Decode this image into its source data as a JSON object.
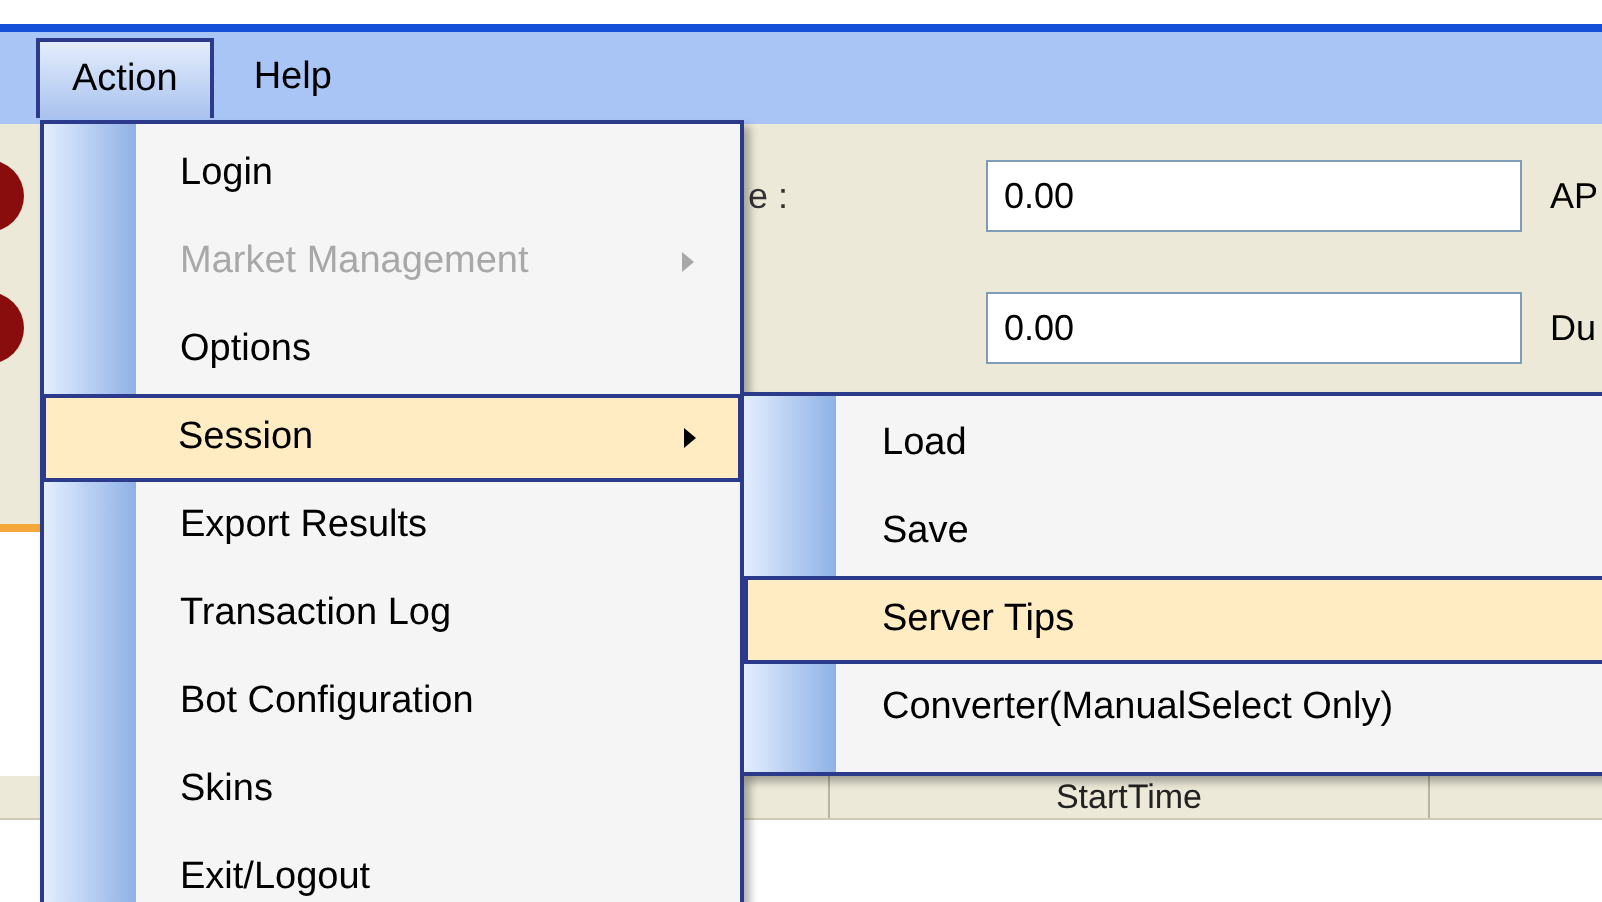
{
  "menu_bar": [
    {
      "label": "Action",
      "selected": true
    },
    {
      "label": "Help",
      "selected": false
    }
  ],
  "form": {
    "rows": [
      {
        "label": "e :",
        "value": "0.00",
        "side_label": "AP"
      },
      {
        "value": "0.00",
        "side_label": "Du"
      }
    ]
  },
  "table": {
    "columns": [
      "StartTime"
    ]
  },
  "action_menu": [
    {
      "label": "Login",
      "disabled": false,
      "selected": false,
      "submenu": false
    },
    {
      "label": "Market Management",
      "disabled": true,
      "selected": false,
      "submenu": true
    },
    {
      "label": "Options",
      "disabled": false,
      "selected": false,
      "submenu": false
    },
    {
      "label": "Session",
      "disabled": false,
      "selected": true,
      "submenu": true
    },
    {
      "label": "Export Results",
      "disabled": false,
      "selected": false,
      "submenu": false
    },
    {
      "label": "Transaction Log",
      "disabled": false,
      "selected": false,
      "submenu": false
    },
    {
      "label": "Bot Configuration",
      "disabled": false,
      "selected": false,
      "submenu": false
    },
    {
      "label": "Skins",
      "disabled": false,
      "selected": false,
      "submenu": false
    },
    {
      "label": "Exit/Logout",
      "disabled": false,
      "selected": false,
      "submenu": false
    }
  ],
  "session_menu": [
    {
      "label": "Load",
      "selected": false
    },
    {
      "label": "Save",
      "selected": false
    },
    {
      "label": "Server Tips",
      "selected": true
    },
    {
      "label": "Converter(ManualSelect Only)",
      "selected": false
    }
  ]
}
